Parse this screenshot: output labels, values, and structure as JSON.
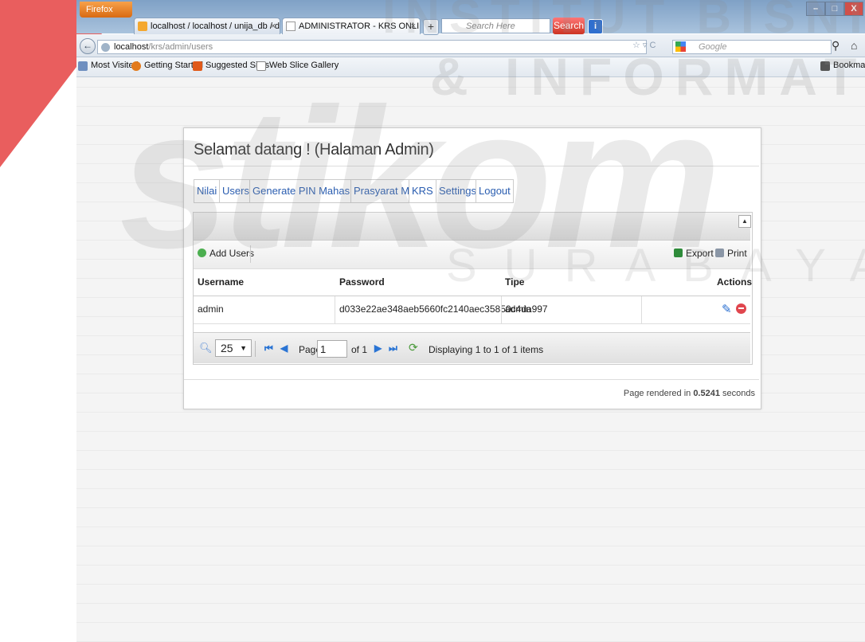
{
  "browser": {
    "menu_button": "Firefox",
    "tabs": [
      {
        "title": "localhost / localhost / unija_db / dev_..."
      },
      {
        "title": "ADMINISTRATOR - KRS ONLINE"
      }
    ],
    "new_tab": "+",
    "search_placeholder": "Search Here",
    "search_button": "Search",
    "url_host": "localhost",
    "url_path": "/krs/admin/users",
    "google_placeholder": "Google",
    "bookmarks": [
      {
        "label": "Most Visited"
      },
      {
        "label": "Getting Started"
      },
      {
        "label": "Suggested Sites"
      },
      {
        "label": "Web Slice Gallery"
      }
    ],
    "bookmarks_menu": "Bookmarks"
  },
  "watermark": {
    "line1": "INSTITUT BISNIS",
    "line2": "& INFORMATIKA",
    "logo": "stikom",
    "city": "SURABAYA"
  },
  "page": {
    "heading": "Selamat datang ! (Halaman Admin)",
    "menu": [
      "Nilai",
      "Users",
      "Generate PIN Mahasiswa",
      "Prasyarat MK",
      "KRS",
      "Settings",
      "Logout"
    ],
    "toolbar": {
      "add": "Add Users",
      "export": "Export",
      "print": "Print"
    },
    "columns": [
      "Username",
      "Password",
      "Tipe",
      "Actions"
    ],
    "rows": [
      {
        "username": "admin",
        "password": "d033e22ae348aeb5660fc2140aec35850c4da997",
        "tipe": "admin"
      }
    ],
    "pager": {
      "page_size": "25",
      "page_label": "Page",
      "page_value": "1",
      "of_label": "of 1",
      "status": "Displaying 1 to 1 of 1 items"
    },
    "footer_prefix": "Page rendered in ",
    "footer_time": "0.5241",
    "footer_suffix": " seconds"
  },
  "colors": {
    "link": "#2a5db0",
    "accent": "#e02828"
  }
}
